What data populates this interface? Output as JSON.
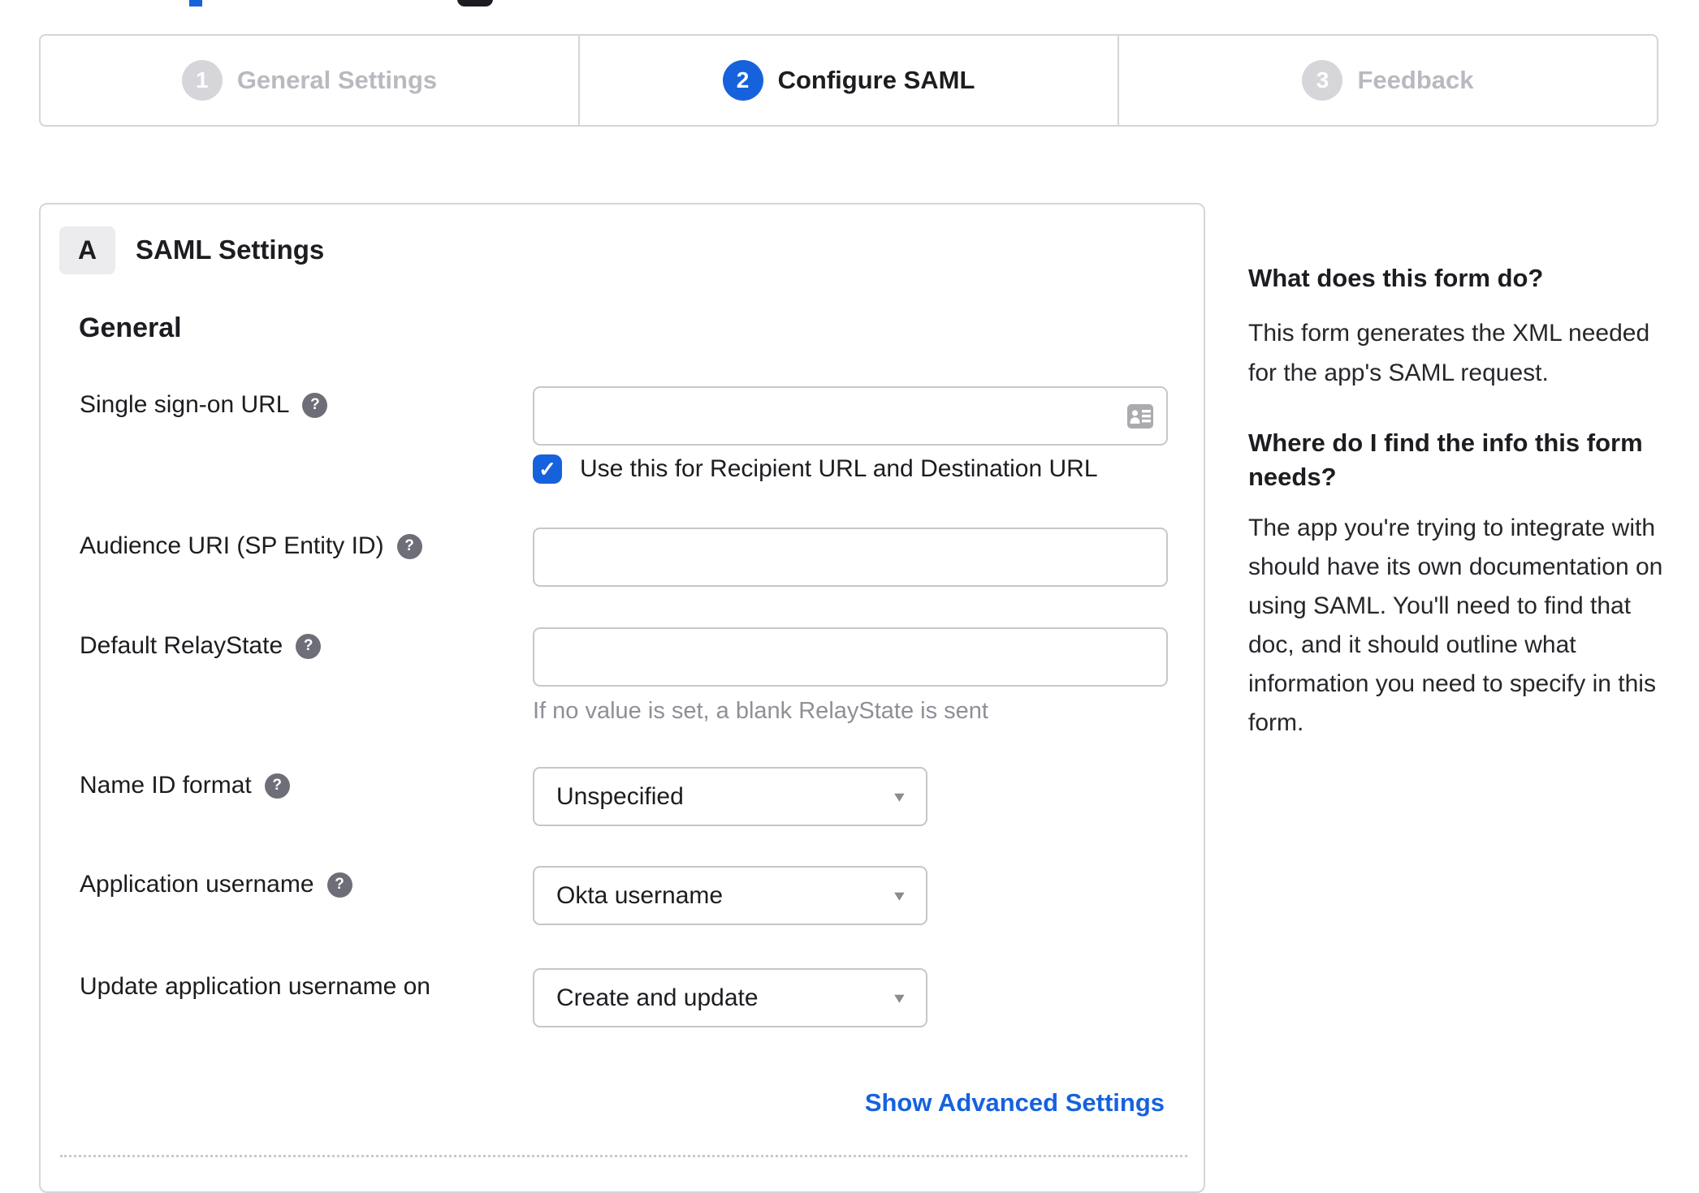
{
  "colors": {
    "accent_blue": "#1662dd",
    "link_blue": "#1662dd",
    "text_dark": "#1d1d21",
    "muted_gray": "#8f8f97",
    "border_gray": "#d5d5da",
    "inactive_step_gray": "#b9b9c0",
    "help_icon_gray": "#6e6e78"
  },
  "stepper": {
    "steps": [
      {
        "number": "1",
        "label": "General Settings",
        "state": "inactive"
      },
      {
        "number": "2",
        "label": "Configure SAML",
        "state": "active"
      },
      {
        "number": "3",
        "label": "Feedback",
        "state": "inactive"
      }
    ]
  },
  "panel": {
    "badge": "A",
    "title": "SAML Settings",
    "section": "General",
    "fields": [
      {
        "label": "Single sign-on URL",
        "value": "",
        "checkbox_label": "Use this for Recipient URL and Destination URL",
        "checkbox_checked": "true"
      },
      {
        "label": "Audience URI (SP Entity ID)",
        "value": ""
      },
      {
        "label": "Default RelayState",
        "value": "",
        "hint": "If no value is set, a blank RelayState is sent"
      },
      {
        "label": "Name ID format",
        "value": "Unspecified"
      },
      {
        "label": "Application username",
        "value": "Okta username"
      },
      {
        "label": "Update application username on",
        "value": "Create and update"
      }
    ],
    "advanced_link": "Show Advanced Settings"
  },
  "sidebar": {
    "question1": "What does this form do?",
    "answer1": "This form generates the XML needed for the app's SAML request.",
    "question2": "Where do I find the info this form needs?",
    "answer2": "The app you're trying to integrate with should have its own documentation on using SAML. You'll need to find that doc, and it should outline what information you need to specify in this form."
  },
  "icons": {
    "help_glyph": "?",
    "check_glyph": "✓",
    "caret_glyph": "▼"
  }
}
